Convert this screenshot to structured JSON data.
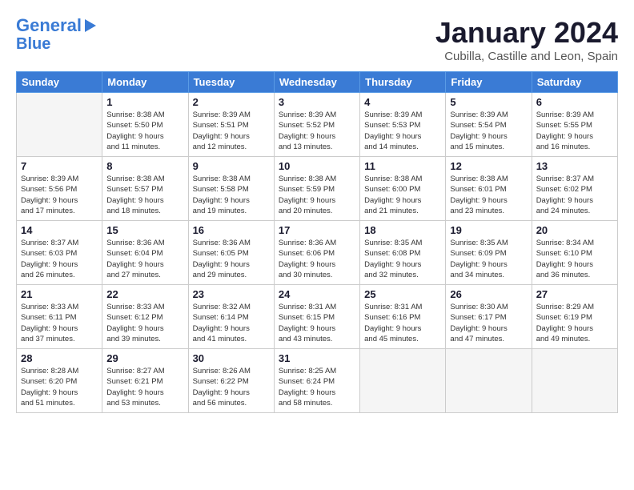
{
  "header": {
    "logo_line1": "General",
    "logo_line2": "Blue",
    "month_title": "January 2024",
    "location": "Cubilla, Castille and Leon, Spain"
  },
  "columns": [
    "Sunday",
    "Monday",
    "Tuesday",
    "Wednesday",
    "Thursday",
    "Friday",
    "Saturday"
  ],
  "weeks": [
    [
      {
        "day": "",
        "info": ""
      },
      {
        "day": "1",
        "info": "Sunrise: 8:38 AM\nSunset: 5:50 PM\nDaylight: 9 hours\nand 11 minutes."
      },
      {
        "day": "2",
        "info": "Sunrise: 8:39 AM\nSunset: 5:51 PM\nDaylight: 9 hours\nand 12 minutes."
      },
      {
        "day": "3",
        "info": "Sunrise: 8:39 AM\nSunset: 5:52 PM\nDaylight: 9 hours\nand 13 minutes."
      },
      {
        "day": "4",
        "info": "Sunrise: 8:39 AM\nSunset: 5:53 PM\nDaylight: 9 hours\nand 14 minutes."
      },
      {
        "day": "5",
        "info": "Sunrise: 8:39 AM\nSunset: 5:54 PM\nDaylight: 9 hours\nand 15 minutes."
      },
      {
        "day": "6",
        "info": "Sunrise: 8:39 AM\nSunset: 5:55 PM\nDaylight: 9 hours\nand 16 minutes."
      }
    ],
    [
      {
        "day": "7",
        "info": "Sunrise: 8:39 AM\nSunset: 5:56 PM\nDaylight: 9 hours\nand 17 minutes."
      },
      {
        "day": "8",
        "info": "Sunrise: 8:38 AM\nSunset: 5:57 PM\nDaylight: 9 hours\nand 18 minutes."
      },
      {
        "day": "9",
        "info": "Sunrise: 8:38 AM\nSunset: 5:58 PM\nDaylight: 9 hours\nand 19 minutes."
      },
      {
        "day": "10",
        "info": "Sunrise: 8:38 AM\nSunset: 5:59 PM\nDaylight: 9 hours\nand 20 minutes."
      },
      {
        "day": "11",
        "info": "Sunrise: 8:38 AM\nSunset: 6:00 PM\nDaylight: 9 hours\nand 21 minutes."
      },
      {
        "day": "12",
        "info": "Sunrise: 8:38 AM\nSunset: 6:01 PM\nDaylight: 9 hours\nand 23 minutes."
      },
      {
        "day": "13",
        "info": "Sunrise: 8:37 AM\nSunset: 6:02 PM\nDaylight: 9 hours\nand 24 minutes."
      }
    ],
    [
      {
        "day": "14",
        "info": "Sunrise: 8:37 AM\nSunset: 6:03 PM\nDaylight: 9 hours\nand 26 minutes."
      },
      {
        "day": "15",
        "info": "Sunrise: 8:36 AM\nSunset: 6:04 PM\nDaylight: 9 hours\nand 27 minutes."
      },
      {
        "day": "16",
        "info": "Sunrise: 8:36 AM\nSunset: 6:05 PM\nDaylight: 9 hours\nand 29 minutes."
      },
      {
        "day": "17",
        "info": "Sunrise: 8:36 AM\nSunset: 6:06 PM\nDaylight: 9 hours\nand 30 minutes."
      },
      {
        "day": "18",
        "info": "Sunrise: 8:35 AM\nSunset: 6:08 PM\nDaylight: 9 hours\nand 32 minutes."
      },
      {
        "day": "19",
        "info": "Sunrise: 8:35 AM\nSunset: 6:09 PM\nDaylight: 9 hours\nand 34 minutes."
      },
      {
        "day": "20",
        "info": "Sunrise: 8:34 AM\nSunset: 6:10 PM\nDaylight: 9 hours\nand 36 minutes."
      }
    ],
    [
      {
        "day": "21",
        "info": "Sunrise: 8:33 AM\nSunset: 6:11 PM\nDaylight: 9 hours\nand 37 minutes."
      },
      {
        "day": "22",
        "info": "Sunrise: 8:33 AM\nSunset: 6:12 PM\nDaylight: 9 hours\nand 39 minutes."
      },
      {
        "day": "23",
        "info": "Sunrise: 8:32 AM\nSunset: 6:14 PM\nDaylight: 9 hours\nand 41 minutes."
      },
      {
        "day": "24",
        "info": "Sunrise: 8:31 AM\nSunset: 6:15 PM\nDaylight: 9 hours\nand 43 minutes."
      },
      {
        "day": "25",
        "info": "Sunrise: 8:31 AM\nSunset: 6:16 PM\nDaylight: 9 hours\nand 45 minutes."
      },
      {
        "day": "26",
        "info": "Sunrise: 8:30 AM\nSunset: 6:17 PM\nDaylight: 9 hours\nand 47 minutes."
      },
      {
        "day": "27",
        "info": "Sunrise: 8:29 AM\nSunset: 6:19 PM\nDaylight: 9 hours\nand 49 minutes."
      }
    ],
    [
      {
        "day": "28",
        "info": "Sunrise: 8:28 AM\nSunset: 6:20 PM\nDaylight: 9 hours\nand 51 minutes."
      },
      {
        "day": "29",
        "info": "Sunrise: 8:27 AM\nSunset: 6:21 PM\nDaylight: 9 hours\nand 53 minutes."
      },
      {
        "day": "30",
        "info": "Sunrise: 8:26 AM\nSunset: 6:22 PM\nDaylight: 9 hours\nand 56 minutes."
      },
      {
        "day": "31",
        "info": "Sunrise: 8:25 AM\nSunset: 6:24 PM\nDaylight: 9 hours\nand 58 minutes."
      },
      {
        "day": "",
        "info": ""
      },
      {
        "day": "",
        "info": ""
      },
      {
        "day": "",
        "info": ""
      }
    ]
  ]
}
